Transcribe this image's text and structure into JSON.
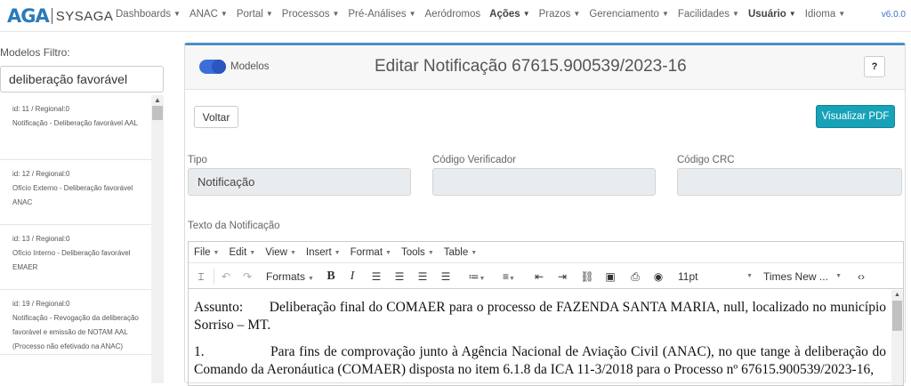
{
  "app": {
    "logo_mark": "AGA",
    "logo_name": "SYSAGA",
    "version": "v6.0.0"
  },
  "nav": [
    {
      "label": "Dashboards",
      "caret": true,
      "bold": false
    },
    {
      "label": "ANAC",
      "caret": true,
      "bold": false
    },
    {
      "label": "Portal",
      "caret": true,
      "bold": false
    },
    {
      "label": "Processos",
      "caret": true,
      "bold": false
    },
    {
      "label": "Pré-Análises",
      "caret": true,
      "bold": false
    },
    {
      "label": "Aeródromos",
      "caret": false,
      "bold": false
    },
    {
      "label": "Ações",
      "caret": true,
      "bold": true
    },
    {
      "label": "Prazos",
      "caret": true,
      "bold": false
    },
    {
      "label": "Gerenciamento",
      "caret": true,
      "bold": false
    },
    {
      "label": "Facilidades",
      "caret": true,
      "bold": false
    },
    {
      "label": "Usuário",
      "caret": true,
      "bold": true
    },
    {
      "label": "Idioma",
      "caret": true,
      "bold": false
    }
  ],
  "sidebar": {
    "filter_label": "Modelos Filtro:",
    "filter_value": "deliberação favorável",
    "items": [
      {
        "meta": "id: 11 / Regional:0",
        "title": "Notificação - Deliberação favorável AAL"
      },
      {
        "meta": "id: 12 / Regional:0",
        "title": "Ofício Externo - Deliberação favorável ANAC"
      },
      {
        "meta": "id: 13 / Regional:0",
        "title": "Ofício Interno - Deliberação favorável EMAER"
      },
      {
        "meta": "id: 19 / Regional:0",
        "title": "Notificação - Revogação da deliberação favorável e emissão de NOTAM AAL (Processo não efetivado na ANAC)"
      }
    ]
  },
  "panel": {
    "toggle_label": "Modelos",
    "title": "Editar Notificação  67615.900539/2023-16",
    "help": "?",
    "back_button": "Voltar",
    "pdf_button": "Visualizar PDF",
    "tipo_label": "Tipo",
    "tipo_value": "Notificação",
    "codigo_label": "Código Verificador",
    "codigo_value": "",
    "crc_label": "Código CRC",
    "crc_value": "",
    "texto_label": "Texto da Notificação"
  },
  "editor": {
    "menus": [
      "File",
      "Edit",
      "View",
      "Insert",
      "Format",
      "Tools",
      "Table"
    ],
    "formats_label": "Formats",
    "font_size": "11pt",
    "font_family": "Times New ...",
    "paragraph1": "Assunto:       Deliberação final do COMAER para o processo de FAZENDA SANTA MARIA, null, localizado no município Sorriso – MT.",
    "paragraph2": "1.                Para fins de comprovação junto à Agência Nacional de Aviação Civil (ANAC), no que tange à deliberação do Comando da Aeronáutica (COMAER) disposta no item 6.1.8 da ICA 11-3/2018 para o Processo nº 67615.900539/2023-16,"
  }
}
